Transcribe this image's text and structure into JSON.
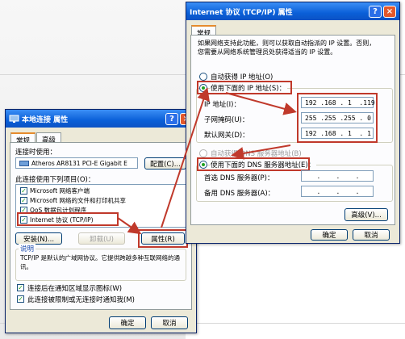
{
  "local_dialog": {
    "title": "本地连接 属性",
    "tabs": [
      "常规",
      "高级"
    ],
    "connect_using_label": "连接时使用：",
    "adapter_name": "Atheros AR8131 PCI-E Gigabit E",
    "configure_button": "配置(C)...",
    "items_label": "此连接使用下列项目(O)：",
    "items": [
      "Microsoft 网络客户端",
      "Microsoft 网络的文件和打印机共享",
      "QoS 数据包计划程序",
      "Internet 协议 (TCP/IP)"
    ],
    "install_button": "安装(N)...",
    "uninstall_button": "卸载(U)",
    "properties_button": "属性(R)",
    "description_label": "说明",
    "description_text": "TCP/IP 是默认的广域网协议。它提供跨越多种互联网络的通讯。",
    "show_icon_checkbox": "连接后在通知区域显示图标(W)",
    "notify_checkbox": "此连接被限制或无连接时通知我(M)",
    "ok_button": "确定",
    "cancel_button": "取消"
  },
  "tcpip_dialog": {
    "title": "Internet 协议 (TCP/IP) 属性",
    "tab": "常规",
    "intro_line1": "如果网络支持此功能，则可以获取自动指派的 IP 设置。否则，",
    "intro_line2": "您需要从网络系统管理员处获得适当的 IP 设置。",
    "auto_ip_radio": "自动获得 IP 地址(O)",
    "manual_ip_radio": "使用下面的 IP 地址(S)：",
    "ip_label": "IP 地址(I)：",
    "ip_value": "192 .168 . 1  .119",
    "mask_label": "子网掩码(U)：",
    "mask_value": "255 .255 .255 . 0",
    "gateway_label": "默认网关(D)：",
    "gateway_value": "192 .168 . 1  . 1",
    "auto_dns_radio": "自动获得 DNS 服务器地址(B)",
    "manual_dns_radio": "使用下面的 DNS 服务器地址(E)：",
    "preferred_dns_label": "首选 DNS 服务器(P)：",
    "alternate_dns_label": "备用 DNS 服务器(A)：",
    "advanced_button": "高级(V)...",
    "ok_button": "确定",
    "cancel_button": "取消"
  },
  "colors": {
    "highlight": "#c0392b",
    "title_bar": "#0a5fd8",
    "dialog_face": "#ece9d8"
  },
  "icons": [
    "network-icon",
    "help-icon",
    "close-icon"
  ]
}
